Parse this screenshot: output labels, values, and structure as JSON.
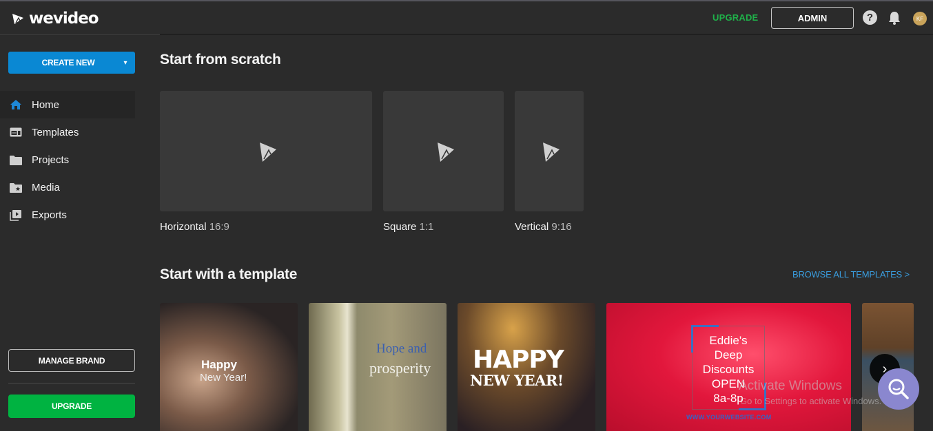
{
  "header": {
    "logo_text": "wevideo",
    "upgrade_label": "UPGRADE",
    "admin_label": "ADMIN",
    "help_glyph": "?",
    "avatar_initials": "KF",
    "icons": [
      "wevideo-logo-icon",
      "help-icon",
      "bell-icon",
      "avatar"
    ]
  },
  "sidebar": {
    "create_new_label": "CREATE NEW",
    "create_caret": "⌄",
    "items": [
      {
        "label": "Home",
        "icon": "home-icon",
        "active": true
      },
      {
        "label": "Templates",
        "icon": "templates-icon",
        "active": false
      },
      {
        "label": "Projects",
        "icon": "folder-icon",
        "active": false
      },
      {
        "label": "Media",
        "icon": "media-folder-star-icon",
        "active": false
      },
      {
        "label": "Exports",
        "icon": "exports-play-icon",
        "active": false
      }
    ],
    "manage_brand_label": "MANAGE BRAND",
    "upgrade_label": "UPGRADE"
  },
  "scratch": {
    "title": "Start from scratch",
    "cards": [
      {
        "name": "Horizontal",
        "ratio": "16:9"
      },
      {
        "name": "Square",
        "ratio": "1:1"
      },
      {
        "name": "Vertical",
        "ratio": "9:16"
      }
    ]
  },
  "templates": {
    "title": "Start with a template",
    "browse_label": "BROWSE ALL TEMPLATES >",
    "cards": [
      {
        "line1": "Happy",
        "line2": "New Year!"
      },
      {
        "line1": "Hope and",
        "line2": "prosperity"
      },
      {
        "line1": "HAPPY",
        "line2": "NEW YEAR!"
      },
      {
        "text": "Eddie's\nDeep\nDiscounts\nOPEN\n8a-8p",
        "lines": [
          "Eddie's",
          "Deep",
          "Discounts",
          "OPEN",
          "8a-8p"
        ],
        "website": "WWW.YOURWEBSITE.COM"
      },
      {}
    ],
    "next_glyph": "›"
  },
  "overlay": {
    "watermark_title": "Activate Windows",
    "watermark_sub": "Go to Settings to activate Windows."
  },
  "colors": {
    "background": "#2b2b2b",
    "accent_blue": "#0a88d3",
    "upgrade_green": "#00b341",
    "link_blue": "#3a9ee0",
    "card": "#393939",
    "search_fab": "#8a87cf",
    "avatar": "#c9a35a"
  }
}
